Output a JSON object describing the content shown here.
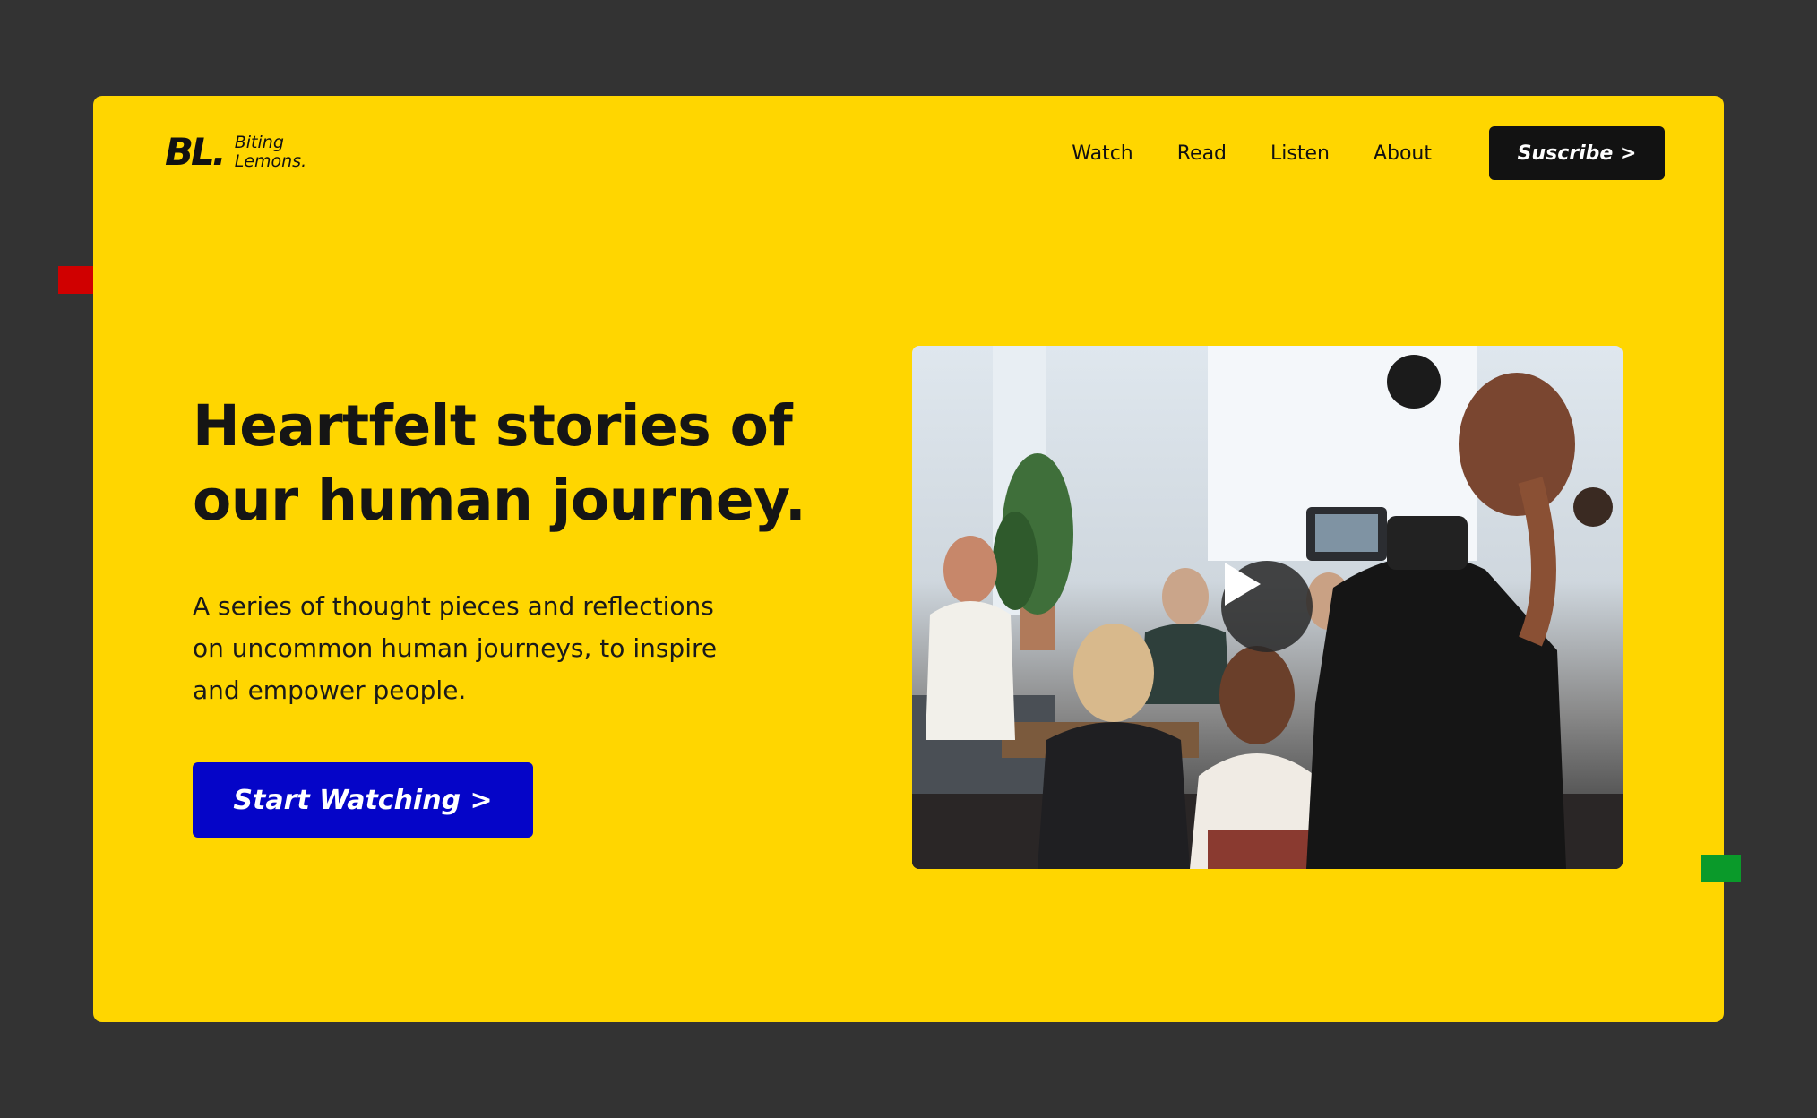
{
  "brand": {
    "mark": "BL.",
    "name_line1": "Biting",
    "name_line2": "Lemons."
  },
  "nav": {
    "links": [
      "Watch",
      "Read",
      "Listen",
      "About"
    ],
    "subscribe_label": "Suscribe >"
  },
  "hero": {
    "title_line1": "Heartfelt stories of",
    "title_line2": "our human journey.",
    "description_lines": [
      "A series of thought pieces and reflections",
      "on uncommon human journeys, to inspire",
      "and empower people."
    ],
    "cta_label": "Start Watching >"
  },
  "video": {
    "play_icon": "play-icon"
  },
  "colors": {
    "page_background": "#333333",
    "card_background": "#FFD600",
    "cta_blue": "#0505C8",
    "subscribe_black": "#121212",
    "accent_red": "#D00000",
    "accent_green": "#0A9A2A"
  }
}
